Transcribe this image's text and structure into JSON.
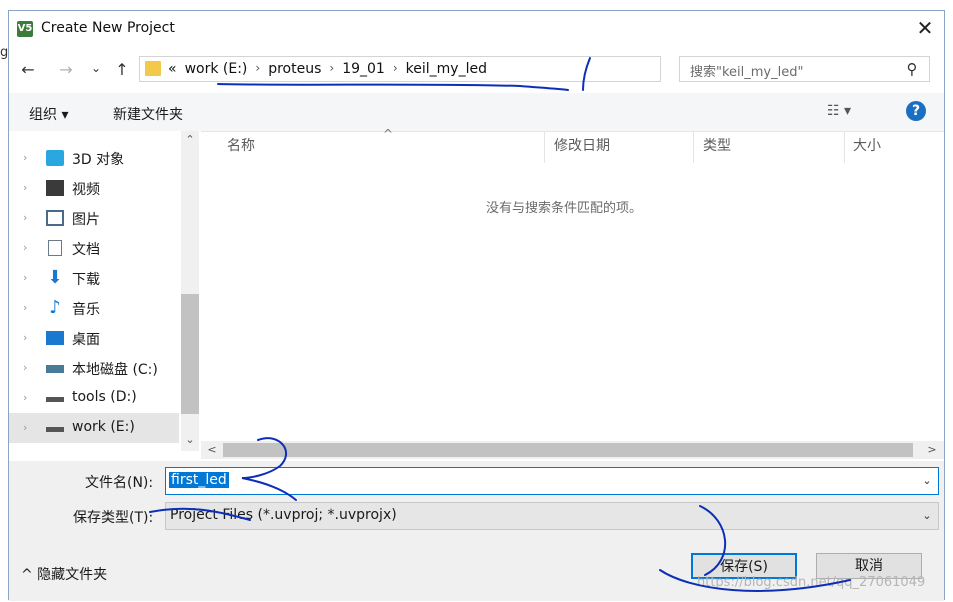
{
  "window": {
    "title": "Create New Project",
    "app_icon_text": "V5",
    "close_glyph": "✕"
  },
  "left_fragment": "g",
  "nav": {
    "back_glyph": "←",
    "forward_glyph": "→",
    "recent_glyph": "⌄",
    "up_glyph": "↑",
    "address": {
      "overflow": "«",
      "crumbs": [
        "work (E:)",
        "proteus",
        "19_01",
        "keil_my_led"
      ],
      "separator": "›",
      "drop_glyph": "⌄",
      "refresh_glyph": "↻"
    },
    "search": {
      "placeholder": "搜索\"keil_my_led\"",
      "icon_glyph": "⚲"
    }
  },
  "toolbar": {
    "organize": "组织 ▾",
    "new_folder": "新建文件夹",
    "view_glyph": "☷ ▾",
    "help_glyph": "?"
  },
  "sidebar": {
    "items": [
      {
        "label": "3D 对象",
        "icon": "cube-icon",
        "color": "#2aa7df"
      },
      {
        "label": "视频",
        "icon": "video-icon",
        "color": "#3a3a3a"
      },
      {
        "label": "图片",
        "icon": "picture-icon",
        "color": "#4a6a8a"
      },
      {
        "label": "文档",
        "icon": "document-icon",
        "color": "#6a7a8a"
      },
      {
        "label": "下载",
        "icon": "download-icon",
        "color": "#1a78d0"
      },
      {
        "label": "音乐",
        "icon": "music-icon",
        "color": "#1a78d0"
      },
      {
        "label": "桌面",
        "icon": "desktop-icon",
        "color": "#1a78d0"
      },
      {
        "label": "本地磁盘 (C:)",
        "icon": "drive-c-icon",
        "color": "#4a7a9a"
      },
      {
        "label": "tools (D:)",
        "icon": "drive-icon",
        "color": "#555555"
      },
      {
        "label": "work (E:)",
        "icon": "drive-icon",
        "color": "#555555",
        "selected": true
      }
    ],
    "chevron_glyph": "›",
    "scroll_up_glyph": "⌃",
    "scroll_down_glyph": "⌄"
  },
  "file_list": {
    "columns": [
      "名称",
      "修改日期",
      "类型",
      "大小"
    ],
    "sort_glyph": "^",
    "empty_message": "没有与搜索条件匹配的项。",
    "hscroll_left": "<",
    "hscroll_right": ">"
  },
  "form": {
    "filename_label": "文件名(N):",
    "filename_value": "first_led",
    "filetype_label": "保存类型(T):",
    "filetype_value": "Project Files (*.uvproj; *.uvprojx)",
    "combo_glyph": "⌄"
  },
  "footer": {
    "hide_folders": "^ 隐藏文件夹",
    "save": "保存(S)",
    "cancel": "取消",
    "watermark": "https://blog.csdn.net/qq_27061049"
  },
  "colors": {
    "accent": "#0078d7",
    "annotation_ink": "#0d2fb8"
  }
}
